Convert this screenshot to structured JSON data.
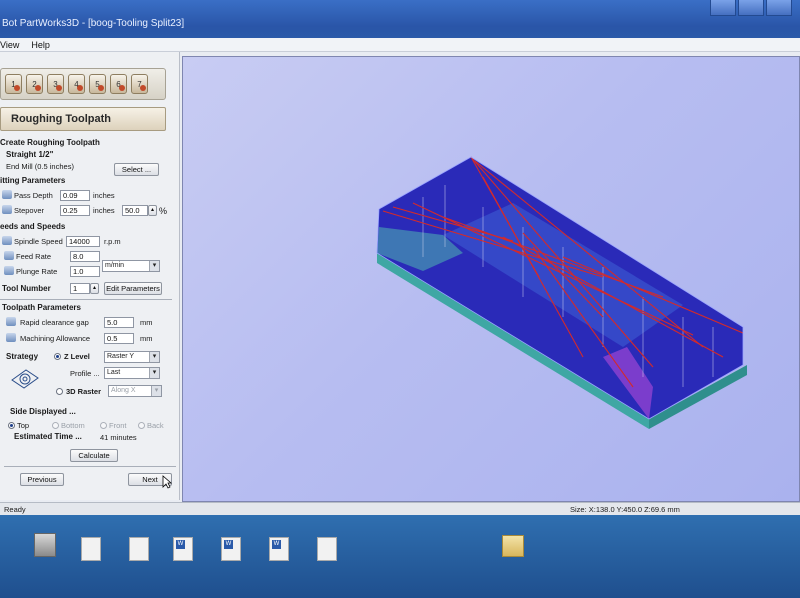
{
  "window": {
    "title": "Bot PartWorks3D - [boog-Tooling Split23]"
  },
  "menu": [
    "View",
    "Help"
  ],
  "toolbar": {
    "buttons": [
      "1",
      "2",
      "3",
      "4",
      "5",
      "6",
      "7"
    ]
  },
  "panel": {
    "header": "Roughing Toolpath",
    "create_section": "Create Roughing Toolpath",
    "tool_name": "Straight 1/2\"",
    "tool_desc": "End Mill (0.5 inches)",
    "select_button": "Select ...",
    "cutting_section": "itting Parameters",
    "pass_depth_label": "Pass Depth",
    "pass_depth_value": "0.09",
    "pass_depth_unit": "inches",
    "stepover_label": "Stepover",
    "stepover_value": "0.25",
    "stepover_unit": "inches",
    "stepover_percent": "50.0",
    "percent_sign": "%",
    "feeds_section": "eeds and Speeds",
    "spindle_label": "Spindle Speed",
    "spindle_value": "14000",
    "spindle_unit": "r.p.m",
    "feed_label": "Feed Rate",
    "feed_value": "8.0",
    "plunge_label": "Plunge Rate",
    "plunge_value": "1.0",
    "rate_unit": "m/min",
    "tool_number_label": "Tool Number",
    "tool_number_value": "1",
    "edit_params_button": "Edit Parameters",
    "toolpath_section": "Toolpath Parameters",
    "rapid_label": "Rapid clearance gap",
    "rapid_value": "5.0",
    "rapid_unit": "mm",
    "allowance_label": "Machining Allowance",
    "allowance_value": "0.5",
    "allowance_unit": "mm",
    "strategy_label": "Strategy",
    "zlevel_label": "Z Level",
    "zlevel_select": "Raster Y",
    "profile_label": "Profile ...",
    "profile_select": "Last",
    "raster3d_label": "3D Raster",
    "raster3d_select": "Along X",
    "side_label": "Side Displayed ...",
    "side_top": "Top",
    "side_bottom": "Bottom",
    "side_front": "Front",
    "side_back": "Back",
    "est_time_label": "Estimated Time ...",
    "est_time_value": "41 minutes",
    "calculate_button": "Calculate",
    "previous_button": "Previous",
    "next_button": "Next"
  },
  "status": {
    "left": "Ready",
    "size": "Size: X:138.0 Y:450.0 Z:69.6 mm"
  },
  "colors": {
    "viewport_bg": "#b7bdf1",
    "toolpath_red": "#d42a2a",
    "model_blue": "#2626b8",
    "model_teal": "#3fa7a4"
  }
}
